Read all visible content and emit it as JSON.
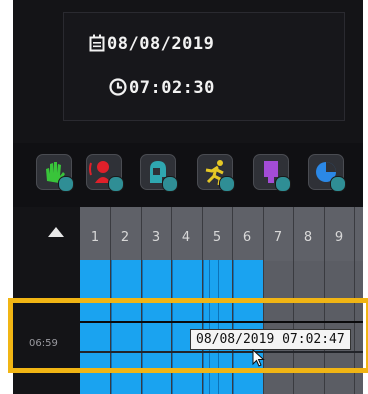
{
  "datetime": {
    "date": "08/08/2019",
    "time": "07:02:30"
  },
  "event_filters": [
    {
      "name": "hand-alarm",
      "color": "#39c43a"
    },
    {
      "name": "person-motion",
      "color": "#e0202a"
    },
    {
      "name": "face",
      "color": "#2fa7b0"
    },
    {
      "name": "running-person",
      "color": "#e6c826"
    },
    {
      "name": "device",
      "color": "#a34cd6"
    },
    {
      "name": "pie-chart",
      "color": "#2b88e6"
    }
  ],
  "channels": [
    "1",
    "2",
    "3",
    "4",
    "5",
    "6",
    "7",
    "8",
    "9"
  ],
  "timeline": {
    "time_label": "06:59",
    "tooltip": "08/08/2019 07:02:47"
  },
  "colors": {
    "recording": "#1aa3f0",
    "highlight": "#f1b514"
  }
}
